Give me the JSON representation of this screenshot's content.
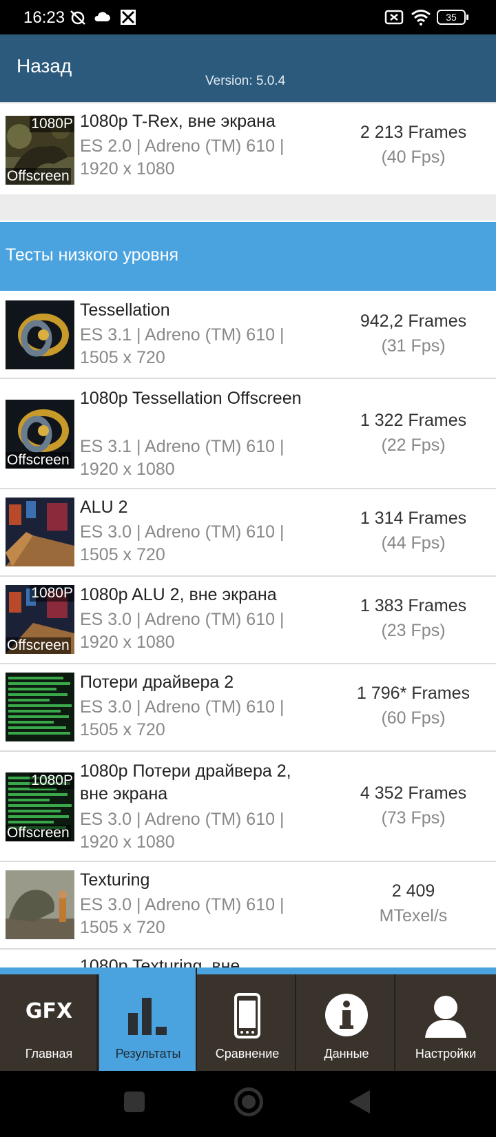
{
  "status_bar": {
    "time": "16:23",
    "battery": "35"
  },
  "header": {
    "back_label": "Назад",
    "version": "Version: 5.0.4"
  },
  "top_row": {
    "badge_top": "1080P",
    "badge_bottom": "Offscreen",
    "title": "1080p T-Rex, вне экрана",
    "sub": "ES 2.0 | Adreno (TM) 610 | 1920 x 1080",
    "score": "2 213 Frames",
    "fps": "(40 Fps)"
  },
  "section_title": "Тесты низкого уровня",
  "tests": [
    {
      "title": "Tessellation",
      "sub": "ES 3.1 | Adreno (TM) 610 | 1505 x 720",
      "score": "942,2 Frames",
      "fps": "(31 Fps)",
      "badge_top": "",
      "badge_bottom": ""
    },
    {
      "title": "1080p Tessellation Offscreen",
      "sub": "ES 3.1 | Adreno (TM) 610 | 1920 x 1080",
      "score": "1 322 Frames",
      "fps": "(22 Fps)",
      "badge_top": "",
      "badge_bottom": "Offscreen"
    },
    {
      "title": "ALU 2",
      "sub": "ES 3.0 | Adreno (TM) 610 | 1505 x 720",
      "score": "1 314 Frames",
      "fps": "(44 Fps)",
      "badge_top": "",
      "badge_bottom": ""
    },
    {
      "title": "1080p ALU 2, вне экрана",
      "sub": "ES 3.0 | Adreno (TM) 610 | 1920 x 1080",
      "score": "1 383 Frames",
      "fps": "(23 Fps)",
      "badge_top": "1080P",
      "badge_bottom": "Offscreen"
    },
    {
      "title": "Потери драйвера 2",
      "sub": "ES 3.0 | Adreno (TM) 610 | 1505 x 720",
      "score": "1 796* Frames",
      "fps": "(60 Fps)",
      "badge_top": "",
      "badge_bottom": ""
    },
    {
      "title": "1080p Потери драйвера 2, вне экрана",
      "sub": "ES 3.0 | Adreno (TM) 610 | 1920 x 1080",
      "score": "4 352 Frames",
      "fps": "(73 Fps)",
      "badge_top": "1080P",
      "badge_bottom": "Offscreen"
    },
    {
      "title": "Texturing",
      "sub": "ES 3.0 | Adreno (TM) 610 | 1505 x 720",
      "score": "2 409",
      "fps": "MTexel/s",
      "badge_top": "",
      "badge_bottom": ""
    }
  ],
  "partial_next": "1080p Texturing, вне",
  "bottom_nav": [
    {
      "label": "Главная",
      "icon": "gfx-logo-icon",
      "logo_text": "GFX",
      "active": false
    },
    {
      "label": "Результаты",
      "icon": "bar-chart-icon",
      "active": true
    },
    {
      "label": "Сравнение",
      "icon": "phone-icon",
      "active": false
    },
    {
      "label": "Данные",
      "icon": "info-icon",
      "active": false
    },
    {
      "label": "Настройки",
      "icon": "person-icon",
      "active": false
    }
  ]
}
